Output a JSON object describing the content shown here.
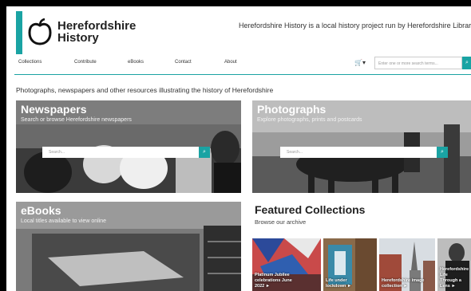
{
  "site": {
    "name_line1": "Herefordshire",
    "name_line2": "History",
    "tagline": "Herefordshire History is a local history project run by Herefordshire Librari"
  },
  "nav": {
    "items": [
      "Collections",
      "Contribute",
      "eBooks",
      "Contact",
      "About"
    ],
    "cart_glyph": "🛒▾",
    "search_placeholder": "Enter one or more search terms...",
    "search_button_icon": "search-icon"
  },
  "intro": "Photographs, newspapers and other resources illustrating the history of Herefordshire",
  "tiles": {
    "newspapers": {
      "title": "Newspapers",
      "subtitle": "Search or browse Herefordshire newspapers",
      "search_placeholder": "Search..."
    },
    "photographs": {
      "title": "Photographs",
      "subtitle": "Explore photographs, prints and postcards",
      "search_placeholder": "Search..."
    },
    "ebooks": {
      "title": "eBooks",
      "subtitle": "Local titles available to view online"
    }
  },
  "featured": {
    "title": "Featured Collections",
    "subtitle": "Browse our archive",
    "cards": [
      {
        "label_line1": "Platinum Jubilee",
        "label_line2": "celebrations June",
        "label_line3": "2022 ►"
      },
      {
        "label_line1": "Life under",
        "label_line2": "lockdown ►",
        "label_line3": ""
      },
      {
        "label_line1": "Herefordshire image",
        "label_line2": "collection ►",
        "label_line3": ""
      },
      {
        "label_line1": "Herefordshire Life",
        "label_line2": "Through a Lens ►",
        "label_line3": ""
      }
    ]
  },
  "colors": {
    "accent": "#1aa3a3"
  }
}
